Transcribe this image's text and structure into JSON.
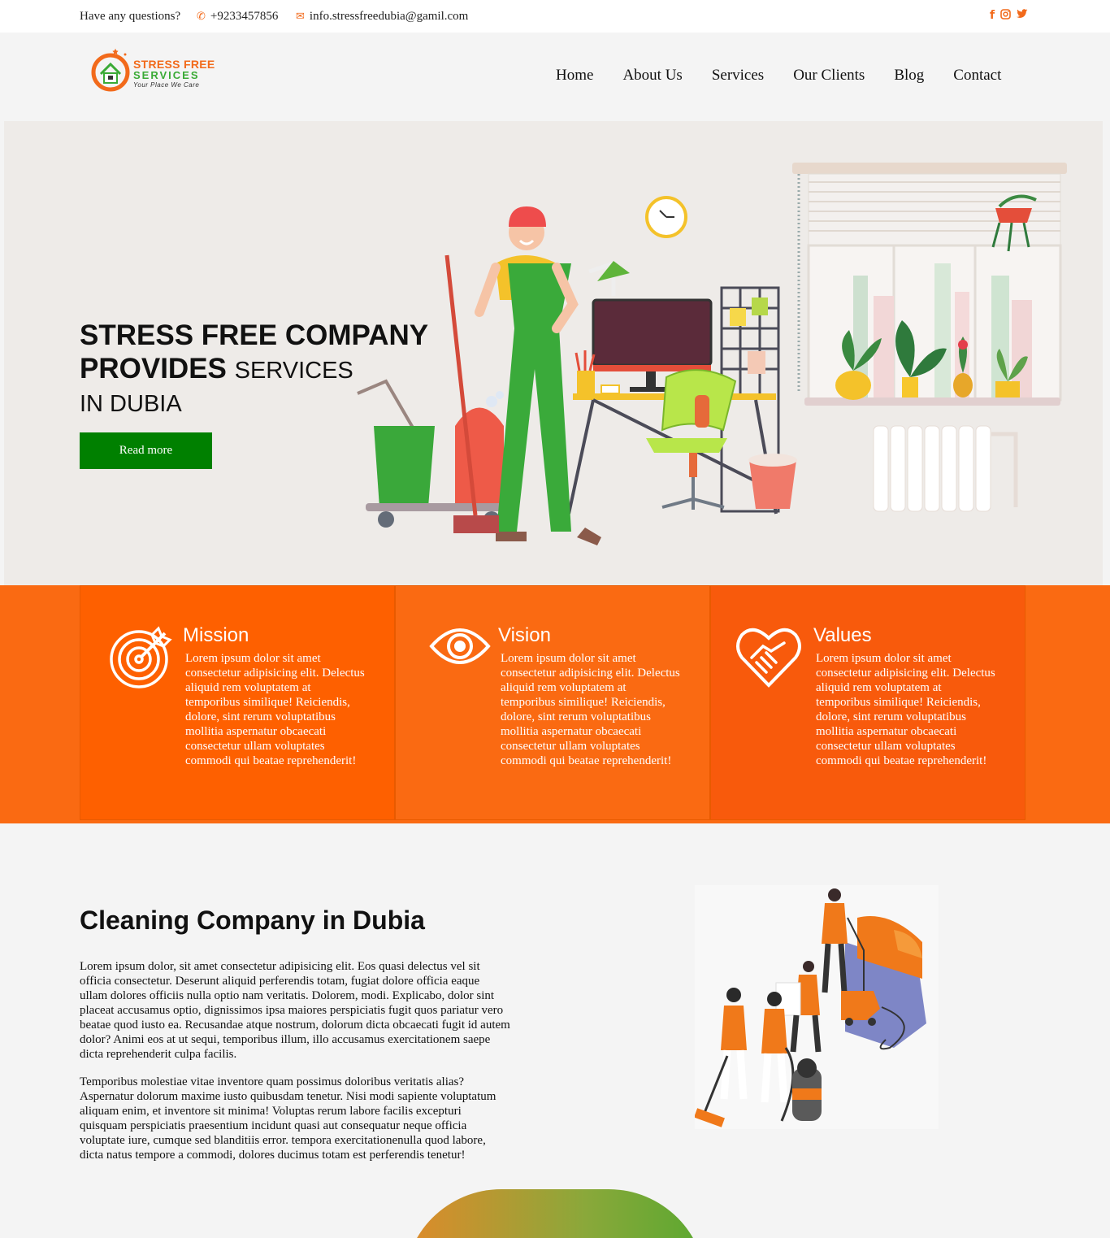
{
  "topbar": {
    "question": "Have any questions?",
    "phone": "+9233457856",
    "email": "info.stressfreedubia@gamil.com",
    "social_icons": [
      "facebook-icon",
      "instagram-icon",
      "twitter-icon"
    ]
  },
  "logo": {
    "line1": "STRESS FREE",
    "line2": "SERVICES",
    "tagline": "Your Place We Care"
  },
  "nav": [
    "Home",
    "About Us",
    "Services",
    "Our Clients",
    "Blog",
    "Contact"
  ],
  "hero": {
    "line1": "STRESS FREE COMPANY",
    "line2_bold": "PROVIDES",
    "line2_thin": "SERVICES",
    "line3": "IN DUBIA",
    "button": "Read more"
  },
  "cards": [
    {
      "title": "Mission",
      "text": "Lorem ipsum dolor sit amet consectetur adipisicing elit. Delectus aliquid rem voluptatem at temporibus similique! Reiciendis, dolore, sint rerum voluptatibus mollitia aspernatur obcaecati consectetur ullam voluptates commodi qui beatae reprehenderit!",
      "icon": "target-icon"
    },
    {
      "title": "Vision",
      "text": "Lorem ipsum dolor sit amet consectetur adipisicing elit. Delectus aliquid rem voluptatem at temporibus similique! Reiciendis, dolore, sint rerum voluptatibus mollitia aspernatur obcaecati consectetur ullam voluptates commodi qui beatae reprehenderit!",
      "icon": "eye-icon"
    },
    {
      "title": "Values",
      "text": "Lorem ipsum dolor sit amet consectetur adipisicing elit. Delectus aliquid rem voluptatem at temporibus similique! Reiciendis, dolore, sint rerum voluptatibus mollitia aspernatur obcaecati consectetur ullam voluptates commodi qui beatae reprehenderit!",
      "icon": "handshake-heart-icon"
    }
  ],
  "about": {
    "title": "Cleaning Company in Dubia",
    "p1": "Lorem ipsum dolor, sit amet consectetur adipisicing elit. Eos quasi delectus vel sit officia consectetur. Deserunt aliquid perferendis totam, fugiat dolore officia eaque ullam dolores officiis nulla optio nam veritatis. Dolorem, modi. Explicabo, dolor sint placeat accusamus optio, dignissimos ipsa maiores perspiciatis fugit quos pariatur vero beatae quod iusto ea. Recusandae atque nostrum, dolorum dicta obcaecati fugit id autem dolor? Animi eos at ut sequi, temporibus illum, illo accusamus exercitationem saepe dicta reprehenderit culpa facilis.",
    "p2": "Temporibus molestiae vitae inventore quam possimus doloribus veritatis alias? Aspernatur dolorum maxime iusto quibusdam tenetur. Nisi modi sapiente voluptatum aliquam enim, et inventore sit minima! Voluptas rerum labore facilis excepturi quisquam perspiciatis praesentium incidunt quasi aut consequatur neque officia voluptate iure, cumque sed blanditiis error. tempora exercitationenulla quod labore, dicta natus tempore a commodi, dolores ducimus totam est perferendis tenetur!"
  },
  "colors": {
    "accent": "#fa6a12",
    "button": "#008000",
    "brand_green": "#3aaa35"
  }
}
